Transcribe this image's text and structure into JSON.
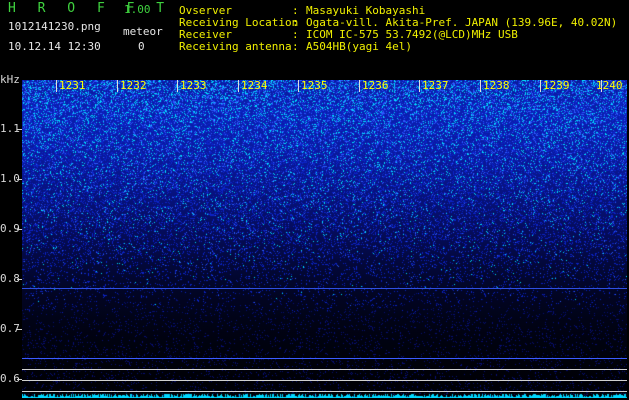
{
  "header": {
    "app_title": "H R O F F T",
    "app_version": "1.00",
    "file_name": "1012141230.png",
    "meteor_label": "meteor",
    "datetime": "10.12.14 12:30",
    "meteor_count": "0"
  },
  "info": [
    {
      "label": "Ovserver",
      "value": "Masayuki Kobayashi"
    },
    {
      "label": "Receiving Location",
      "value": "Ogata-vill. Akita-Pref. JAPAN (139.96E, 40.02N)"
    },
    {
      "label": "Receiver",
      "value": "ICOM IC-575 53.7492(@LCD)MHz USB"
    },
    {
      "label": "Receiving antenna",
      "value": "A504HB(yagi 4el)"
    }
  ],
  "info_separator": ":",
  "axis": {
    "y_unit": "kHz",
    "y_ticks": [
      "1.1",
      "1.0",
      "0.9",
      "0.8",
      "0.7",
      "0.6"
    ],
    "x_ticks": [
      "1231",
      "1232",
      "1233",
      "1234",
      "1235",
      "1236",
      "1237",
      "1238",
      "1239",
      "1240"
    ]
  },
  "colors": {
    "title": "#3fd23f",
    "info_text": "#f0f000",
    "tick_labels": "#ffff00",
    "noise_high": "#00e5ff",
    "noise_mid": "#1a3cff",
    "background": "#000000"
  }
}
